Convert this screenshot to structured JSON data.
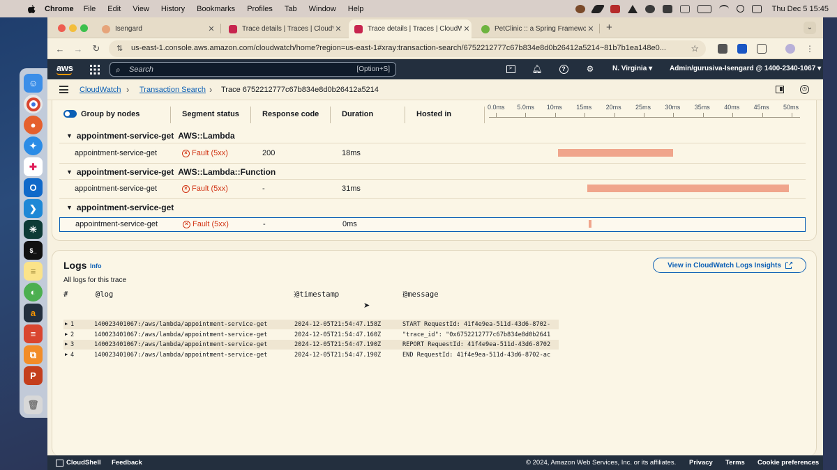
{
  "menubar": {
    "app": "Chrome",
    "items": [
      "File",
      "Edit",
      "View",
      "History",
      "Bookmarks",
      "Profiles",
      "Tab",
      "Window",
      "Help"
    ],
    "clock": "Thu Dec 5  15:45"
  },
  "tabs": [
    {
      "title": "Isengard",
      "color": "#e6a47a",
      "active": false
    },
    {
      "title": "Trace details | Traces | CloudW",
      "color": "#c7254e",
      "active": false
    },
    {
      "title": "Trace details | Traces | CloudW",
      "color": "#c7254e",
      "active": true
    },
    {
      "title": "PetClinic :: a Spring Framewo",
      "color": "#6db33f",
      "active": false
    }
  ],
  "address": {
    "url": "us-east-1.console.aws.amazon.com/cloudwatch/home?region=us-east-1#xray:transaction-search/6752212777c67b834e8d0b26412a5214~81b7b1ea148e0..."
  },
  "aws_header": {
    "logo": "aws",
    "search_placeholder": "Search",
    "search_shortcut": "[Option+S]",
    "region": "N. Virginia",
    "account": "Admin/gurusiva-Isengard @ 1400-2340-1067"
  },
  "breadcrumb": {
    "items": [
      "CloudWatch",
      "Transaction Search"
    ],
    "current": "Trace 6752212777c67b834e8d0b26412a5214"
  },
  "segments_table": {
    "group_toggle_label": "Group by nodes",
    "columns": [
      "Segment status",
      "Response code",
      "Duration",
      "Hosted in"
    ],
    "timeline_ticks": [
      "0.0ms",
      "5.0ms",
      "10ms",
      "15ms",
      "20ms",
      "25ms",
      "30ms",
      "35ms",
      "40ms",
      "45ms",
      "50ms"
    ],
    "timeline_max_ms": 50,
    "groups": [
      {
        "name": "appointment-service-get",
        "type": "AWS::Lambda",
        "rows": [
          {
            "name": "appointment-service-get",
            "status": "Fault (5xx)",
            "code": "200",
            "duration": "18ms",
            "start_ms": 10.5,
            "duration_ms": 19.5,
            "selected": false
          }
        ]
      },
      {
        "name": "appointment-service-get",
        "type": "AWS::Lambda::Function",
        "rows": [
          {
            "name": "appointment-service-get",
            "status": "Fault (5xx)",
            "code": "-",
            "duration": "31ms",
            "start_ms": 15.5,
            "duration_ms": 34,
            "selected": false
          }
        ]
      },
      {
        "name": "appointment-service-get",
        "type": "",
        "rows": [
          {
            "name": "appointment-service-get",
            "status": "Fault (5xx)",
            "code": "-",
            "duration": "0ms",
            "start_ms": 15.6,
            "duration_ms": 0.4,
            "selected": true
          }
        ]
      }
    ]
  },
  "logs": {
    "title": "Logs",
    "info": "Info",
    "subtitle": "All logs for this trace",
    "view_button": "View in CloudWatch Logs Insights",
    "columns": [
      "#",
      "@log",
      "@timestamp",
      "@message"
    ],
    "rows": [
      {
        "n": "1",
        "log": "140023401067:/aws/lambda/appointment-service-get",
        "ts": "2024-12-05T21:54:47.158Z",
        "msg": "START RequestId: 41f4e9ea-511d-43d6-8702-"
      },
      {
        "n": "2",
        "log": "140023401067:/aws/lambda/appointment-service-get",
        "ts": "2024-12-05T21:54:47.160Z",
        "msg": "\"trace_id\": \"0x6752212777c67b834e8d0b2641"
      },
      {
        "n": "3",
        "log": "140023401067:/aws/lambda/appointment-service-get",
        "ts": "2024-12-05T21:54:47.190Z",
        "msg": "REPORT RequestId: 41f4e9ea-511d-43d6-8702"
      },
      {
        "n": "4",
        "log": "140023401067:/aws/lambda/appointment-service-get",
        "ts": "2024-12-05T21:54:47.190Z",
        "msg": "END RequestId: 41f4e9ea-511d-43d6-8702-ac"
      }
    ]
  },
  "footer": {
    "cloudshell": "CloudShell",
    "feedback": "Feedback",
    "copyright": "© 2024, Amazon Web Services, Inc. or its affiliates.",
    "privacy": "Privacy",
    "terms": "Terms",
    "cookies": "Cookie preferences"
  },
  "colors": {
    "aws_dark": "#232f3e",
    "link": "#0b5fb5",
    "fault": "#d13212",
    "bar": "#f0a58c",
    "smile": "#ff9900"
  }
}
